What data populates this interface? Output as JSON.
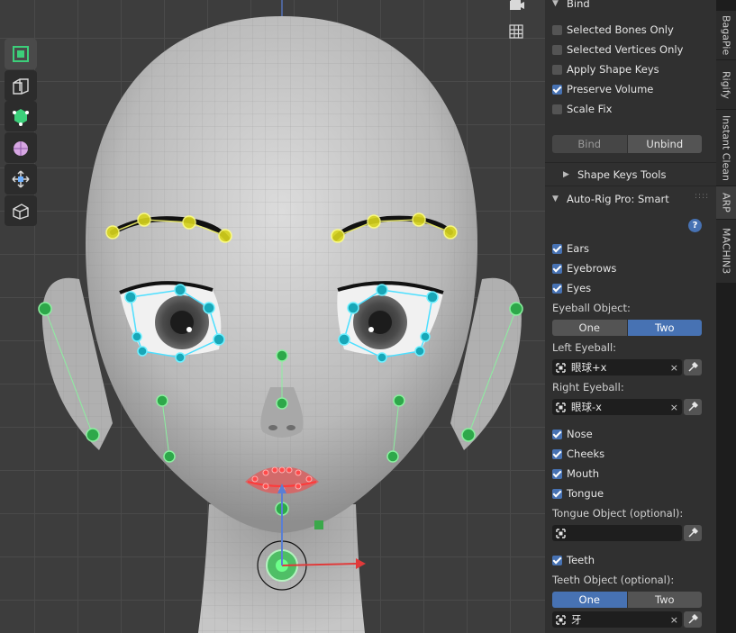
{
  "viewport_tools": [
    {
      "name": "edit-mode-cube-icon"
    },
    {
      "name": "extrude-icon"
    },
    {
      "name": "select-box-icon"
    },
    {
      "name": "sculpt-sphere-icon"
    },
    {
      "name": "move-arrows-icon"
    },
    {
      "name": "box-add-icon"
    }
  ],
  "panel": {
    "bind_header": "Bind",
    "bind_options": [
      {
        "label": "Selected Bones Only",
        "checked": false
      },
      {
        "label": "Selected Vertices Only",
        "checked": false
      },
      {
        "label": "Apply Shape Keys",
        "checked": false
      },
      {
        "label": "Preserve Volume",
        "checked": true
      },
      {
        "label": "Scale Fix",
        "checked": false
      }
    ],
    "bind_button": "Bind",
    "unbind_button": "Unbind",
    "shape_keys_header": "Shape Keys Tools",
    "smart_header": "Auto-Rig Pro: Smart",
    "help_icon": "?",
    "ears": "Ears",
    "eyebrows": "Eyebrows",
    "eyes": "Eyes",
    "eyeball_object_label": "Eyeball Object:",
    "eyeball_one": "One",
    "eyeball_two": "Two",
    "left_eyeball_label": "Left Eyeball:",
    "left_eyeball_value": "眼球+x",
    "right_eyeball_label": "Right Eyeball:",
    "right_eyeball_value": "眼球-x",
    "nose": "Nose",
    "cheeks": "Cheeks",
    "mouth": "Mouth",
    "tongue": "Tongue",
    "tongue_object_label": "Tongue Object (optional):",
    "teeth": "Teeth",
    "teeth_object_label": "Teeth Object (optional):",
    "teeth_one": "One",
    "teeth_two": "Two",
    "teeth_value": "牙",
    "clear_icon": "×"
  },
  "tabs": [
    "BagaPie",
    "Rigify",
    "Instant Clean",
    "ARP",
    "MACHIN3"
  ],
  "colors": {
    "accent": "#4772b3",
    "panel_bg": "#303030",
    "tab_bar": "#1d1d1d"
  }
}
